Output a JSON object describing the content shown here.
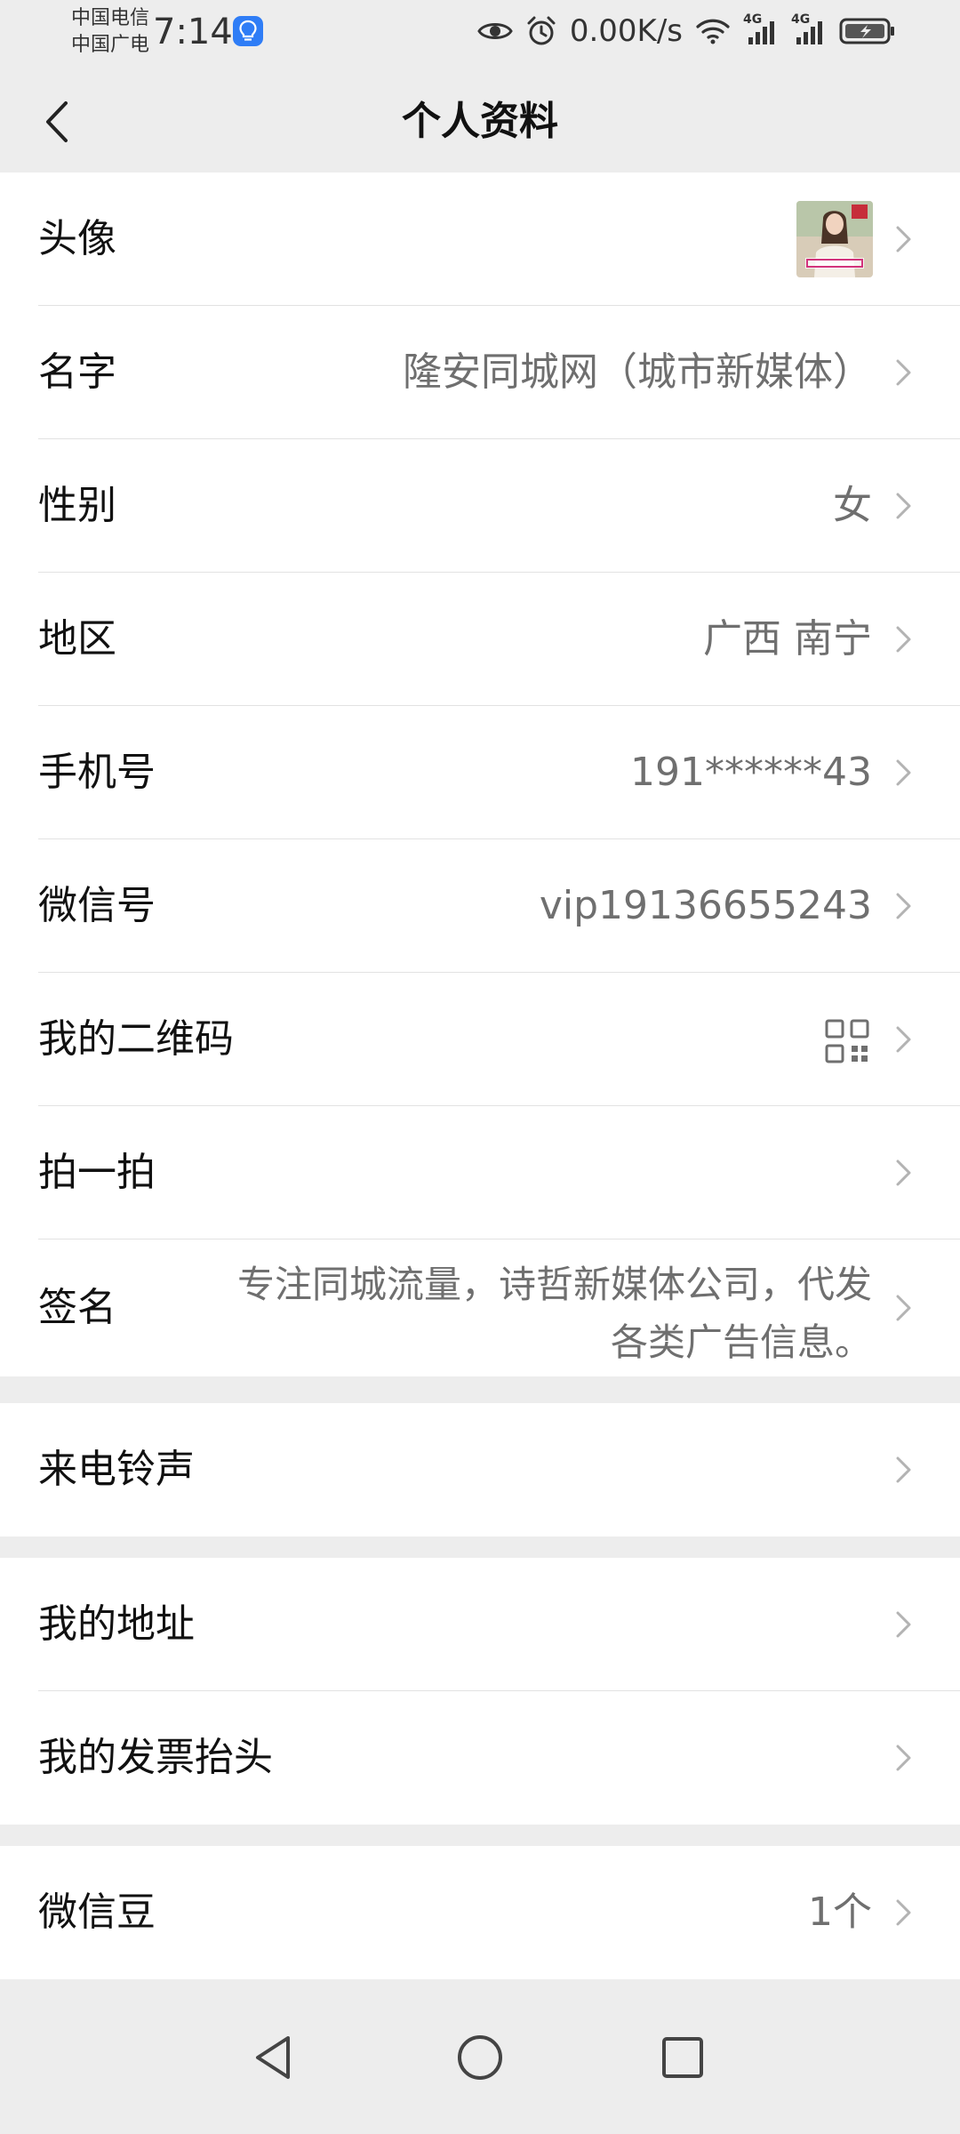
{
  "status_bar": {
    "carrier_1": "中国电信",
    "carrier_2": "中国广电",
    "time": "7:14",
    "net_speed": "0.00K/s",
    "signal_1_label": "4G",
    "signal_2_label": "4G",
    "icons": [
      "lightbulb-icon",
      "eye-icon",
      "alarm-icon",
      "wifi-icon",
      "signal-icon",
      "battery-charging-icon"
    ]
  },
  "header": {
    "title": "个人资料",
    "back_icon": "chevron-left-icon"
  },
  "group_1": {
    "rows": [
      {
        "label": "头像",
        "value": "",
        "value_type": "avatar-image"
      },
      {
        "label": "名字",
        "value": "隆安同城网（城市新媒体）"
      },
      {
        "label": "性别",
        "value": "女"
      },
      {
        "label": "地区",
        "value": "广西 南宁"
      },
      {
        "label": "手机号",
        "value": "191******43"
      },
      {
        "label": "微信号",
        "value": "vip19136655243"
      },
      {
        "label": "我的二维码",
        "value": "",
        "value_type": "qr-code-icon"
      },
      {
        "label": "拍一拍",
        "value": ""
      },
      {
        "label": "签名",
        "value_line_1": "专注同城流量，诗哲新媒体公司，代发",
        "value_line_2": "各类广告信息。"
      }
    ]
  },
  "group_2": {
    "rows": [
      {
        "label": "来电铃声"
      }
    ]
  },
  "group_3": {
    "rows": [
      {
        "label": "我的地址"
      },
      {
        "label": "我的发票抬头"
      }
    ]
  },
  "group_4": {
    "rows": [
      {
        "label": "微信豆",
        "value": "1个"
      }
    ]
  },
  "nav_bar": {
    "icons": [
      "back-triangle-icon",
      "home-circle-icon",
      "recents-square-icon"
    ]
  },
  "colors": {
    "background": "#ededed",
    "card": "#ffffff",
    "primary_text": "#111111",
    "secondary_text": "#6f6f6f",
    "chevron": "#b3b3b3",
    "divider": "#e2e2e2",
    "badge_blue": "#2f7df6"
  }
}
